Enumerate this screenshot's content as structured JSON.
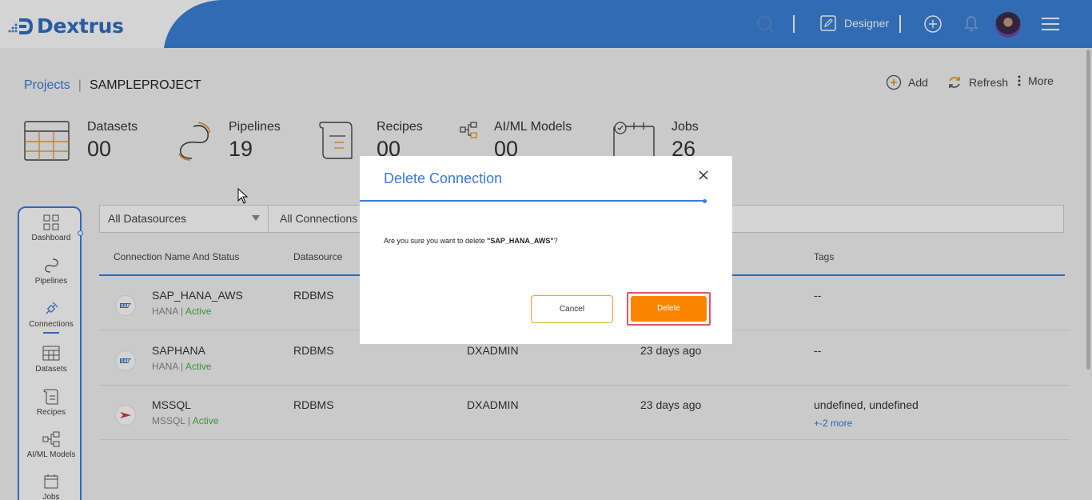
{
  "app": {
    "name": "Dextrus"
  },
  "topbar": {
    "mode_label": "Designer",
    "search_icon": "search-icon",
    "add_icon": "plus-circle-icon",
    "bell_icon": "bell-icon",
    "menu_icon": "hamburger-icon",
    "accent": "#2f6fc1"
  },
  "breadcrumb": {
    "root": "Projects",
    "separator": "|",
    "current": "SAMPLEPROJECT"
  },
  "actions": {
    "add": "Add",
    "refresh": "Refresh",
    "more": "More"
  },
  "stats": [
    {
      "label": "Datasets",
      "value": "00",
      "icon": "table-icon"
    },
    {
      "label": "Pipelines",
      "value": "19",
      "icon": "pipeline-icon"
    },
    {
      "label": "Recipes",
      "value": "00",
      "icon": "scroll-icon"
    },
    {
      "label": "AI/ML Models",
      "value": "00",
      "icon": "model-icon"
    },
    {
      "label": "Jobs",
      "value": "26",
      "icon": "calendar-icon"
    }
  ],
  "sidebar": {
    "items": [
      {
        "label": "Dashboard",
        "icon": "grid-icon"
      },
      {
        "label": "Pipelines",
        "icon": "pipeline-icon"
      },
      {
        "label": "Connections",
        "icon": "plug-icon",
        "active": true
      },
      {
        "label": "Datasets",
        "icon": "table-icon"
      },
      {
        "label": "Recipes",
        "icon": "scroll-icon"
      },
      {
        "label": "AI/ML Models",
        "icon": "model-icon"
      },
      {
        "label": "Jobs",
        "icon": "calendar-icon"
      }
    ]
  },
  "filters": {
    "datasource": "All Datasources",
    "connections": "All Connections"
  },
  "table": {
    "headers": {
      "name": "Connection Name And Status",
      "datasource": "Datasource",
      "tags": "Tags"
    },
    "rows": [
      {
        "name": "SAP_HANA_AWS",
        "type": "HANA",
        "status": "Active",
        "datasource": "RDBMS",
        "owner": "",
        "modified": "",
        "tags": "--",
        "more": ""
      },
      {
        "name": "SAPHANA",
        "type": "HANA",
        "status": "Active",
        "datasource": "RDBMS",
        "owner": "DXADMIN",
        "modified": "23 days ago",
        "tags": "--",
        "more": ""
      },
      {
        "name": "MSSQL",
        "type": "MSSQL",
        "status": "Active",
        "datasource": "RDBMS",
        "owner": "DXADMIN",
        "modified": "23 days ago",
        "tags": "undefined, undefined",
        "more": "+-2 more"
      }
    ]
  },
  "modal": {
    "title": "Delete Connection",
    "message_prefix": "Are you sure you want to delete ",
    "message_target": "\"SAP_HANA_AWS\"",
    "message_suffix": "?",
    "cancel": "Cancel",
    "delete": "Delete",
    "delete_color": "#fb8500"
  }
}
